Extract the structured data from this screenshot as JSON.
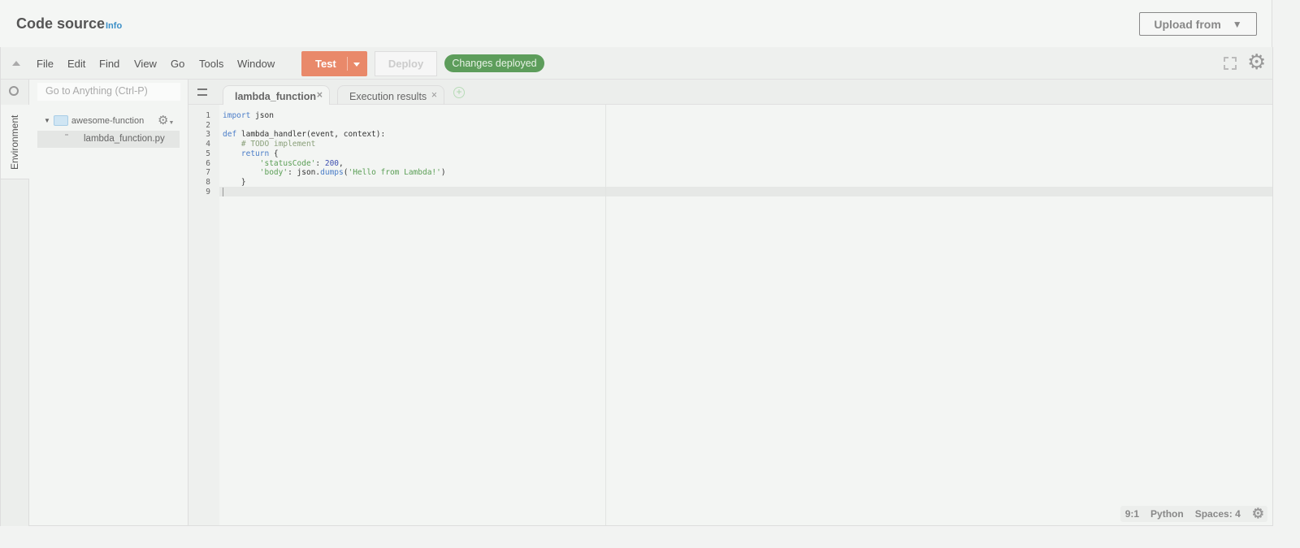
{
  "header": {
    "title": "Code source",
    "info": "Info",
    "upload": "Upload from",
    "upload_caret": "▼"
  },
  "menu": [
    "File",
    "Edit",
    "Find",
    "View",
    "Go",
    "Tools",
    "Window"
  ],
  "toolbar": {
    "test": "Test",
    "deploy": "Deploy",
    "status": "Changes deployed"
  },
  "sidebar": {
    "goto_placeholder": "Go to Anything (Ctrl-P)",
    "env_tab": "Environment",
    "folder": "awesome-function",
    "file": "lambda_function.py"
  },
  "tabs": [
    {
      "label": "lambda_function",
      "close": "×"
    },
    {
      "label": "Execution results",
      "close": "×"
    }
  ],
  "code": {
    "line_numbers": "1\n2\n3\n4\n5\n6\n7\n8\n9",
    "l1a": "import",
    "l1b": " json",
    "l3a": "def",
    "l3b": " lambda_handler(event, context):",
    "l4": "    # TODO implement",
    "l5a": "    return",
    "l5b": " {",
    "l6a": "        'statusCode'",
    "l6b": ": ",
    "l6c": "200",
    "l6d": ",",
    "l7a": "        'body'",
    "l7b": ": json.",
    "l7c": "dumps",
    "l7d": "(",
    "l7e": "'Hello from Lambda!'",
    "l7f": ")",
    "l8": "    }"
  },
  "statusbar": {
    "position": "9:1",
    "language": "Python",
    "indent": "Spaces: 4"
  }
}
